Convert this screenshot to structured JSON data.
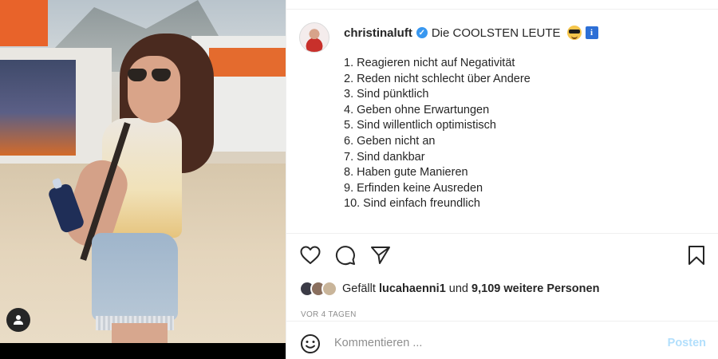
{
  "post": {
    "username": "christinaluft",
    "caption_title": "Die COOLSTEN LEUTE",
    "verified_mark": "✓",
    "info_emoji": "i",
    "caption_items": [
      "1. Reagieren nicht auf Negativität",
      "2. Reden nicht schlecht über Andere",
      "3. Sind pünktlich",
      "4. Geben ohne Erwartungen",
      "5. Sind willentlich optimistisch",
      "6. Geben nicht an",
      "7. Sind dankbar",
      "8. Haben gute Manieren",
      "9. Erfinden keine Ausreden",
      "10. Sind einfach freundlich"
    ]
  },
  "likes": {
    "prefix": "Gefällt",
    "user": "lucahaenni1",
    "connector": "und",
    "others": "9,109 weitere Personen"
  },
  "timestamp": "VOR 4 TAGEN",
  "comment": {
    "placeholder": "Kommentieren ...",
    "post_label": "Posten"
  },
  "icons": {
    "like": "heart-icon",
    "comment": "comment-icon",
    "share": "send-icon",
    "save": "bookmark-icon",
    "emoji": "smiley-icon",
    "user_tag": "user-icon"
  },
  "colors": {
    "text": "#262626",
    "muted": "#8e8e8e",
    "verified": "#3897f0",
    "post_disabled": "#b2dffc"
  }
}
